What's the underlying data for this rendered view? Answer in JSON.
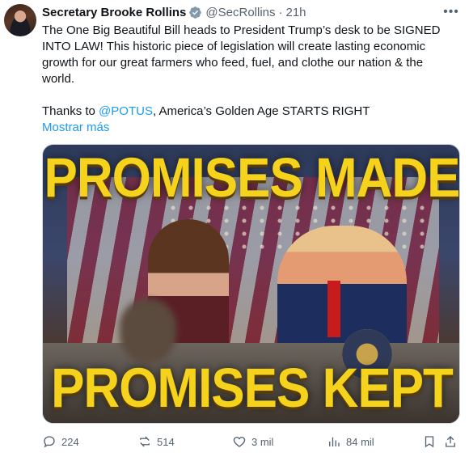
{
  "tweet": {
    "author_name": "Secretary Brooke Rollins",
    "handle": "@SecRollins",
    "separator": "·",
    "time": "21h",
    "text_p1": "The One Big Beautiful Bill heads to President Trump’s desk to be SIGNED INTO LAW! This historic piece of legislation will create lasting economic growth for our great farmers who feed, fuel, and clothe our nation & the world.",
    "text_p2_prefix": "Thanks to ",
    "mention": "@POTUS",
    "text_p2_suffix": ", America’s Golden Age STARTS RIGHT",
    "show_more": "Mostrar más",
    "more_icon": "more-horizontal-icon",
    "verified_color": "#1d9bf0",
    "link_color": "#1d9bf0"
  },
  "media": {
    "headline_top": "PROMISES MADE",
    "headline_bottom": "PROMISES KEPT",
    "headline_color": "#f5d21b"
  },
  "actions": {
    "replies": "224",
    "reposts": "514",
    "likes": "3 mil",
    "views": "84 mil"
  }
}
